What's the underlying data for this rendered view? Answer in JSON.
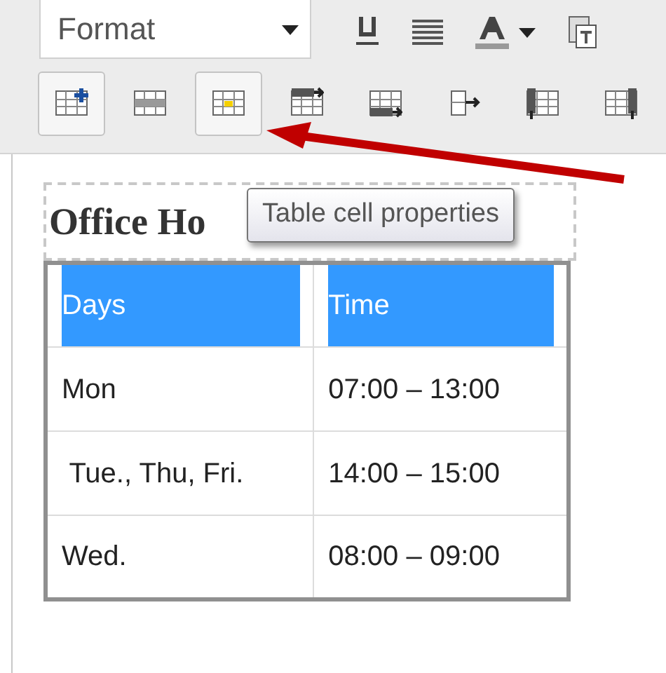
{
  "toolbar_row_1": {
    "format_dropdown": {
      "value": "Format"
    },
    "buttons": [
      {
        "kind": "underline"
      },
      {
        "kind": "justify"
      },
      {
        "kind": "text-color"
      },
      {
        "kind": "caret"
      },
      {
        "kind": "paste-text"
      }
    ]
  },
  "toolbar_row_2": [
    {
      "kind": "insert-table",
      "pressed": true
    },
    {
      "kind": "row-properties",
      "pressed": false
    },
    {
      "kind": "cell-properties",
      "pressed": true
    },
    {
      "kind": "insert-row-before",
      "pressed": false
    },
    {
      "kind": "insert-row-after",
      "pressed": false
    },
    {
      "kind": "delete-row",
      "pressed": false
    },
    {
      "kind": "insert-col-before",
      "pressed": false
    },
    {
      "kind": "insert-col-after",
      "pressed": false
    }
  ],
  "tooltip": "Table cell properties",
  "editor": {
    "heading": "Office Ho",
    "table": {
      "rows": [
        [
          {
            "text": "Days",
            "selected": true
          },
          {
            "text": "Time",
            "selected": true
          }
        ],
        [
          {
            "text": "Mon",
            "selected": false
          },
          {
            "text": "07:00 – 13:00",
            "selected": false
          }
        ],
        [
          {
            "text": " Tue., Thu, Fri.",
            "selected": false
          },
          {
            "text": "14:00 – 15:00",
            "selected": false
          }
        ],
        [
          {
            "text": "Wed.",
            "selected": false
          },
          {
            "text": "08:00 – 09:00",
            "selected": false
          }
        ]
      ]
    }
  }
}
